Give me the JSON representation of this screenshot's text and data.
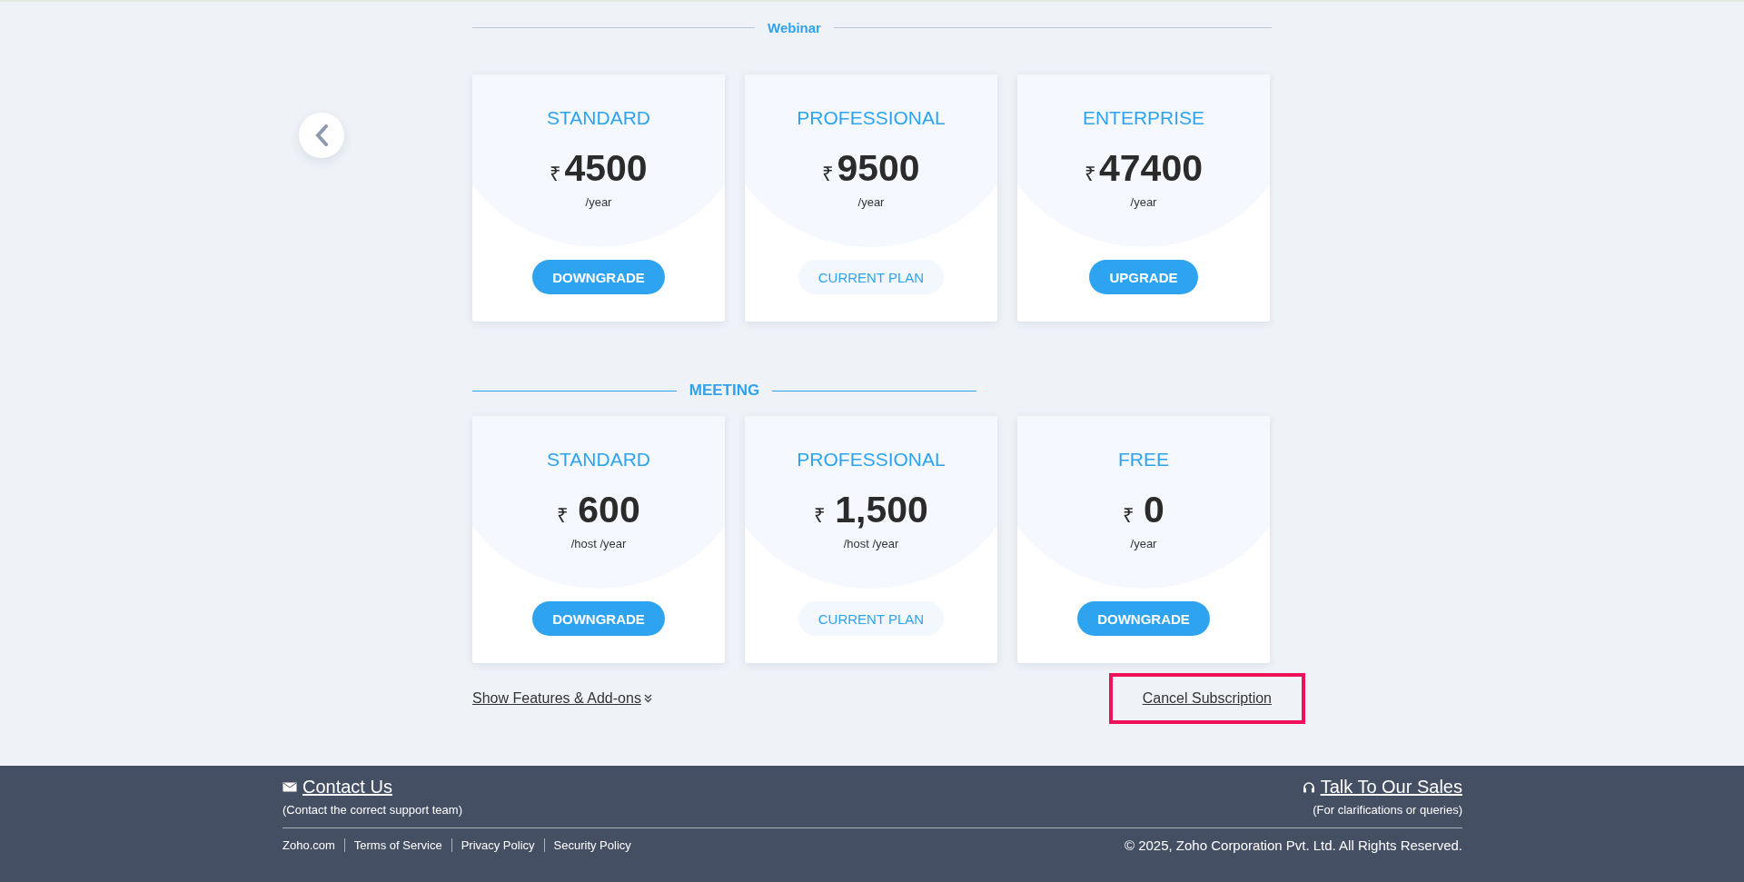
{
  "sections": [
    {
      "title": "Webinar",
      "plans": [
        {
          "name": "STANDARD",
          "currency": "₹",
          "amount": "4500",
          "period": "/year",
          "button": {
            "label": "DOWNGRADE",
            "kind": "primary"
          }
        },
        {
          "name": "PROFESSIONAL",
          "currency": "₹",
          "amount": "9500",
          "period": "/year",
          "button": {
            "label": "CURRENT PLAN",
            "kind": "current"
          }
        },
        {
          "name": "ENTERPRISE",
          "currency": "₹",
          "amount": "47400",
          "period": "/year",
          "button": {
            "label": "UPGRADE",
            "kind": "primary"
          }
        }
      ]
    },
    {
      "title": "MEETING",
      "plans": [
        {
          "name": "STANDARD",
          "currency": "₹",
          "amount": "600",
          "period": "/host /year",
          "button": {
            "label": "DOWNGRADE",
            "kind": "primary"
          }
        },
        {
          "name": "PROFESSIONAL",
          "currency": "₹",
          "amount": "1,500",
          "period": "/host /year",
          "button": {
            "label": "CURRENT PLAN",
            "kind": "current"
          }
        },
        {
          "name": "FREE",
          "currency": "₹",
          "amount": "0",
          "period": "/year",
          "button": {
            "label": "DOWNGRADE",
            "kind": "primary"
          }
        }
      ]
    }
  ],
  "features_link": {
    "label": "Show Features & Add-ons"
  },
  "cancel_link": {
    "label": "Cancel Subscription",
    "highlighted": true
  },
  "footer": {
    "contact": {
      "title": "Contact Us",
      "note": "(Contact the correct support team)"
    },
    "sales": {
      "title": "Talk To Our Sales",
      "note": "(For clarifications or queries)"
    },
    "links": [
      "Zoho.com",
      "Terms of Service",
      "Privacy Policy",
      "Security Policy"
    ],
    "copyright": "© 2025, Zoho Corporation Pvt. Ltd. All Rights Reserved."
  }
}
